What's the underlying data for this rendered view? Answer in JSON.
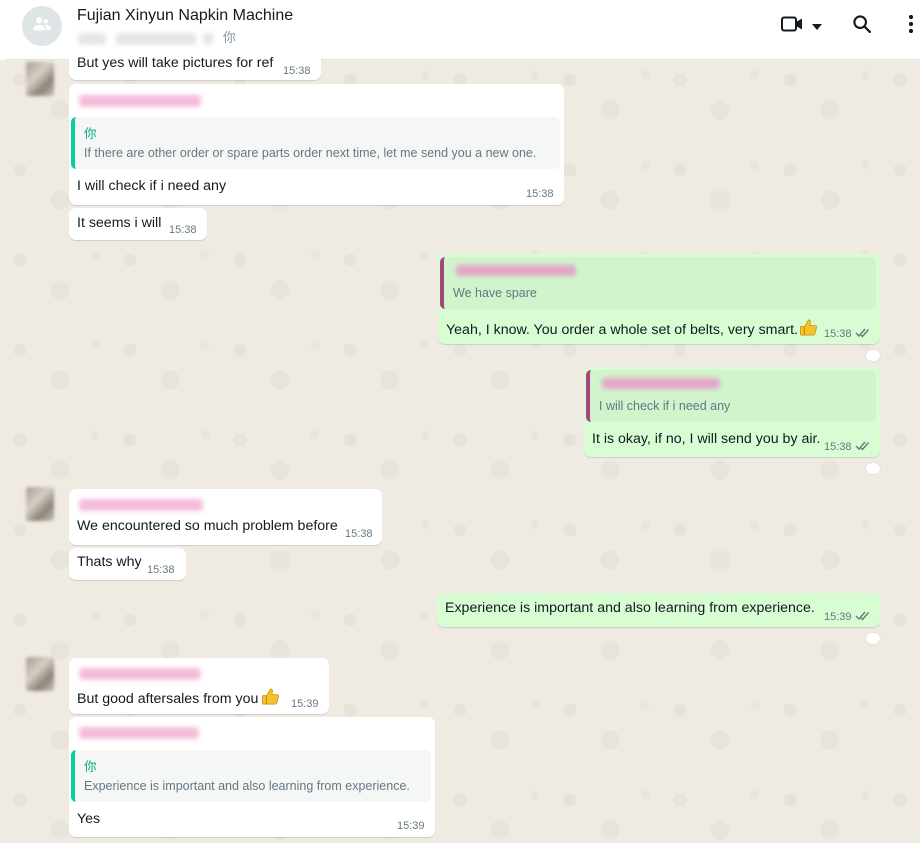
{
  "header": {
    "title": "Fujian Xinyun Napkin Machine",
    "participants_self": "你",
    "icons": [
      "group-icon",
      "video-call-icon",
      "chevron-down-icon",
      "search-icon",
      "menu-icon"
    ]
  },
  "colors": {
    "incoming": "#ffffff",
    "outgoing": "#d9fdd3",
    "quote_self_bar": "#06cf9c",
    "quote_other_bar": "#a5447f",
    "wallpaper": "#efeae2"
  },
  "messages": [
    {
      "dir": "in",
      "text": "But yes will take pictures for ref",
      "time": "15:38"
    },
    {
      "dir": "in",
      "quote_author": "你",
      "quote_text": "If there are other order or spare parts order next time, let me send you a new one.",
      "text": "I will check if i need any",
      "time": "15:38"
    },
    {
      "dir": "in",
      "text": "It seems i will",
      "time": "15:38"
    },
    {
      "dir": "out",
      "quote_text": "We have spare",
      "text": "Yeah, I know. You order a whole set of belts, very smart.",
      "emoji": "thumbs-up",
      "time": "15:38"
    },
    {
      "dir": "out",
      "quote_text": "I will check if i need any",
      "text": "It is okay, if no, I will send you by air.",
      "time": "15:38"
    },
    {
      "dir": "in",
      "text": "We encountered so much problem before",
      "time": "15:38"
    },
    {
      "dir": "in",
      "text": "Thats why",
      "time": "15:38"
    },
    {
      "dir": "out",
      "text": "Experience is important and also learning from experience.",
      "time": "15:39"
    },
    {
      "dir": "in",
      "text": "But good aftersales from you",
      "emoji": "thumbs-up",
      "time": "15:39"
    },
    {
      "dir": "in",
      "quote_author": "你",
      "quote_text": "Experience is important and also learning from experience.",
      "text": "Yes",
      "time": "15:39"
    }
  ]
}
